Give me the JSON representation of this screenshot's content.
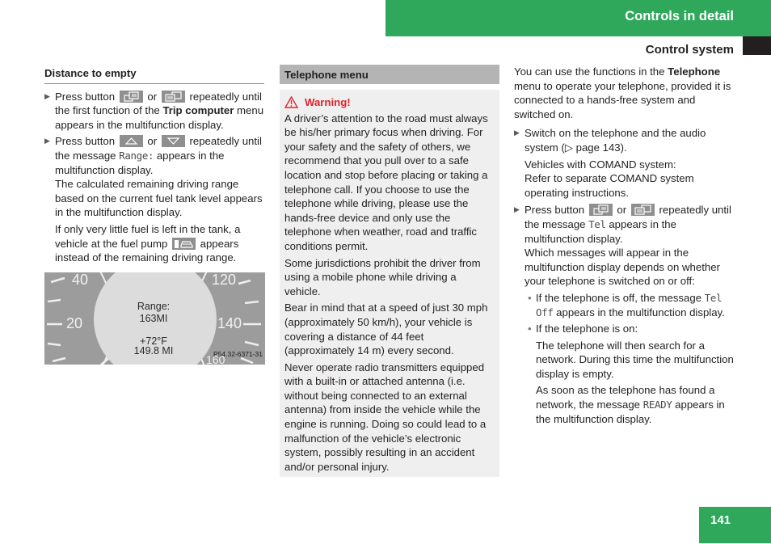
{
  "header": {
    "chapter_title": "Controls in detail",
    "section_title": "Control system",
    "accent_color": "#2fa85c"
  },
  "left_column": {
    "heading": "Distance to empty",
    "step1": {
      "pre": "Press button",
      "or": "or",
      "post": "repeatedly until the first function of the",
      "bold": "Trip computer",
      "tail": "menu appears in the multifunction display.",
      "icons": [
        "display-prev-icon",
        "display-next-icon"
      ]
    },
    "step2": {
      "pre": "Press button",
      "or": "or",
      "post": "repeatedly until the message",
      "message": "Range:",
      "tail": "appears in the multifunction display.",
      "extra": "The calculated remaining driving range based on the current fuel tank level appears in the multifunction display.",
      "icons": [
        "arrow-up-icon",
        "arrow-down-icon"
      ]
    },
    "fuel_note": {
      "pre": "If only very little fuel is left in the tank, a vehicle at the fuel pump",
      "post": "appears instead of the remaining driving range.",
      "icon": "vehicle-at-fuel-pump-icon"
    },
    "figure": {
      "speed_labels": [
        "40",
        "20",
        "120",
        "140",
        "160"
      ],
      "display_line1": "Range:",
      "display_line2": "163MI",
      "display_line3": "+72°F",
      "display_line4": "149.8 MI",
      "figure_code": "P54.32-6371-31"
    }
  },
  "middle_column": {
    "heading": "Telephone menu",
    "warning_title": "Warning!",
    "warning_color": "#e2212b",
    "paragraphs": [
      "A driver’s attention to the road must always be his/her primary focus when driving. For your safety and the safety of others, we recommend that you pull over to a safe location and stop before placing or taking a telephone call. If you choose to use the telephone while driving, please use the hands-free device and only use the telephone when weather, road and traffic conditions permit.",
      "Some jurisdictions prohibit the driver from using a mobile phone while driving a vehicle.",
      "Bear in mind that at a speed of just 30 mph (approximately 50 km/h), your vehicle is covering a distance of 44 feet (approximately 14 m) every second.",
      "Never operate radio transmitters equipped with a built-in or attached antenna (i.e. without being connected to an external antenna) from inside the vehicle while the engine is running. Doing so could lead to a malfunction of the vehicle’s electronic system, possibly resulting in an accident and/or personal injury."
    ]
  },
  "right_column": {
    "intro_pre": "You can use the functions in the",
    "intro_bold": "Telephone",
    "intro_post": "menu to operate your telephone, provided it is connected to a hands-free system and switched on.",
    "step1": {
      "text_pre": "Switch on the telephone and the audio system (",
      "page_ref": "▷ page 143",
      "text_post": ").",
      "note1": "Vehicles with COMAND system:",
      "note2": "Refer to separate COMAND system operating instructions."
    },
    "step2": {
      "pre": "Press button",
      "or": "or",
      "post": "repeatedly until the message",
      "message": "Tel",
      "tail": "appears in the multifunction display.",
      "extra": "Which messages will appear in the multifunction display depends on whether your telephone is switched on or off:"
    },
    "bullet1": {
      "pre": "If the telephone is off, the message",
      "message": "Tel Off",
      "post": "appears in the multifunction display."
    },
    "bullet2": {
      "text": "If the telephone is on:",
      "para1": "The telephone will then search for a network. During this time the multifunction display is empty.",
      "para2_pre": "As soon as the telephone has found a network, the message",
      "para2_msg": "READY",
      "para2_post": "appears in the multifunction display."
    }
  },
  "footer": {
    "page_number": "141"
  }
}
